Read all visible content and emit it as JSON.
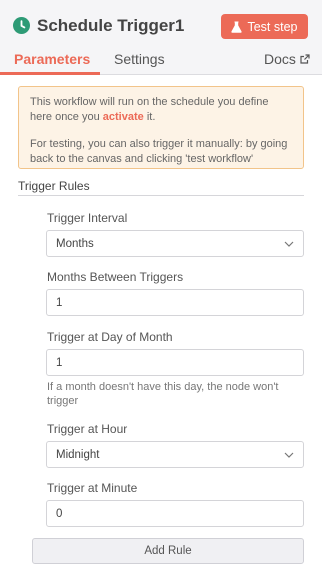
{
  "header": {
    "title": "Schedule Trigger1",
    "test_step_label": "Test step",
    "node_icon": "clock-icon",
    "test_icon": "flask-icon",
    "brand_color": "#ec6a57",
    "node_icon_color": "#2e9b76"
  },
  "tabs": [
    {
      "label": "Parameters",
      "active": true
    },
    {
      "label": "Settings",
      "active": false
    },
    {
      "label": "Docs",
      "active": false,
      "icon": "external-link-icon"
    }
  ],
  "notice": {
    "line1_before": "This workflow will run on the schedule you define here once you ",
    "line1_accent": "activate",
    "line1_after": " it.",
    "line2": "For testing, you can also trigger it manually: by going back to the canvas and clicking 'test workflow'"
  },
  "section": {
    "title": "Trigger Rules"
  },
  "fields": {
    "interval": {
      "label": "Trigger Interval",
      "value": "Months"
    },
    "months_between": {
      "label": "Months Between Triggers",
      "value": "1"
    },
    "day_of_month": {
      "label": "Trigger at Day of Month",
      "value": "1",
      "hint": "If a month doesn't have this day, the node won't trigger"
    },
    "hour": {
      "label": "Trigger at Hour",
      "value": "Midnight"
    },
    "minute": {
      "label": "Trigger at Minute",
      "value": "0"
    }
  },
  "add_rule_label": "Add Rule"
}
